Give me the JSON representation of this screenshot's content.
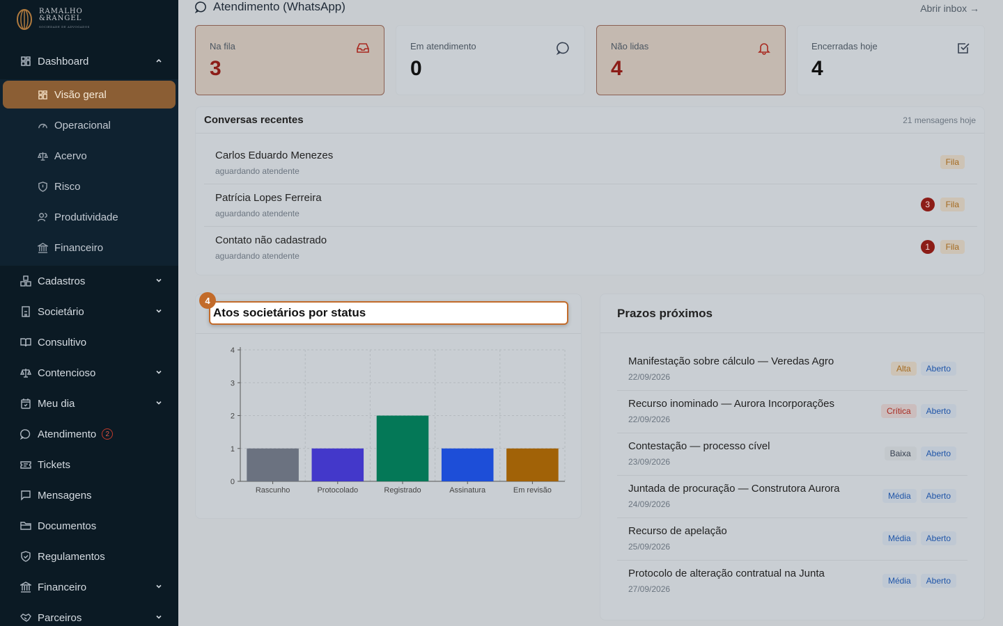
{
  "brand": {
    "line1": "RAMALHO",
    "line2": "&RANGEL",
    "tagline": "SOCIEDADE DE ADVOGADOS"
  },
  "sidebar": {
    "dashboard": "Dashboard",
    "sub": [
      {
        "label": "Visão geral",
        "icon": "grid-icon"
      },
      {
        "label": "Operacional",
        "icon": "gauge-icon"
      },
      {
        "label": "Acervo",
        "icon": "scale-icon"
      },
      {
        "label": "Risco",
        "icon": "shield-icon"
      },
      {
        "label": "Produtividade",
        "icon": "users-icon"
      },
      {
        "label": "Financeiro",
        "icon": "bank-icon"
      }
    ],
    "items": [
      {
        "label": "Cadastros",
        "icon": "boxes-icon"
      },
      {
        "label": "Societário",
        "icon": "building-icon"
      },
      {
        "label": "Consultivo",
        "icon": "book-icon"
      },
      {
        "label": "Contencioso",
        "icon": "scale-icon"
      },
      {
        "label": "Meu dia",
        "icon": "calendar-icon"
      },
      {
        "label": "Atendimento",
        "icon": "chat-icon",
        "badge": "2"
      },
      {
        "label": "Tickets",
        "icon": "ticket-icon"
      },
      {
        "label": "Mensagens",
        "icon": "message-icon"
      },
      {
        "label": "Documentos",
        "icon": "folder-icon"
      },
      {
        "label": "Regulamentos",
        "icon": "shield-check-icon"
      },
      {
        "label": "Financeiro",
        "icon": "bank-icon"
      },
      {
        "label": "Parceiros",
        "icon": "handshake-icon"
      }
    ]
  },
  "whatsapp": {
    "title": "Atendimento (WhatsApp)",
    "open_inbox": "Abrir inbox →",
    "stats": [
      {
        "label": "Na fila",
        "value": "3"
      },
      {
        "label": "Em atendimento",
        "value": "0"
      },
      {
        "label": "Não lidas",
        "value": "4"
      },
      {
        "label": "Encerradas hoje",
        "value": "4"
      }
    ]
  },
  "recent": {
    "title": "Conversas recentes",
    "meta": "21 mensagens hoje",
    "items": [
      {
        "name": "Carlos Eduardo Menezes",
        "status": "aguardando atendente",
        "unread": "",
        "tag": "Fila"
      },
      {
        "name": "Patrícia Lopes Ferreira",
        "status": "aguardando atendente",
        "unread": "3",
        "tag": "Fila"
      },
      {
        "name": "Contato não cadastrado",
        "status": "aguardando atendente",
        "unread": "1",
        "tag": "Fila"
      }
    ]
  },
  "chart_marker": "4",
  "chart_data": {
    "type": "bar",
    "title": "Atos societários por status",
    "categories": [
      "Rascunho",
      "Protocolado",
      "Registrado",
      "Assinatura",
      "Em revisão"
    ],
    "values": [
      1,
      1,
      2,
      1,
      1
    ],
    "colors": [
      "#6b7280",
      "#4338ca",
      "#047857",
      "#1d4ed8",
      "#a16207"
    ],
    "ylim": [
      0,
      4
    ],
    "yticks": [
      "0",
      "1",
      "2",
      "3",
      "4"
    ],
    "grid": true
  },
  "deadlines": {
    "title": "Prazos próximos",
    "items": [
      {
        "name": "Manifestação sobre cálculo — Veredas Agro",
        "date": "22/09/2026",
        "priority": "Alta",
        "status": "Aberto"
      },
      {
        "name": "Recurso inominado — Aurora Incorporações",
        "date": "22/09/2026",
        "priority": "Crítica",
        "status": "Aberto"
      },
      {
        "name": "Contestação — processo cível",
        "date": "23/09/2026",
        "priority": "Baixa",
        "status": "Aberto"
      },
      {
        "name": "Juntada de procuração — Construtora Aurora",
        "date": "24/09/2026",
        "priority": "Média",
        "status": "Aberto"
      },
      {
        "name": "Recurso de apelação",
        "date": "25/09/2026",
        "priority": "Média",
        "status": "Aberto"
      },
      {
        "name": "Protocolo de alteração contratual na Junta",
        "date": "27/09/2026",
        "priority": "Média",
        "status": "Aberto"
      }
    ]
  }
}
